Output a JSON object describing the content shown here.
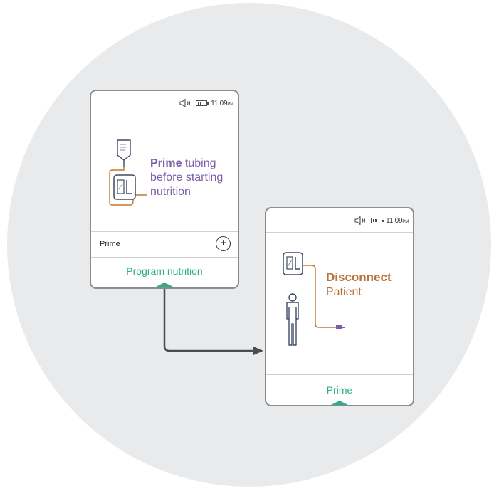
{
  "colors": {
    "accent": "#2fae85",
    "prime_purple": "#7b5ea7",
    "disconnect_orange": "#b9733a",
    "background_circle": "#e9eaeb",
    "device_border": "#8a8c8e",
    "connector": "#4a4c4e"
  },
  "screen_prime": {
    "status": {
      "time": "11:09",
      "ampm": "PM",
      "icons": [
        "speaker-icon",
        "battery-icon"
      ]
    },
    "message": {
      "bold": "Prime",
      "rest": " tubing before starting nutrition"
    },
    "illustration": [
      "iv-bag-icon",
      "pump-icon"
    ],
    "prime_row": {
      "label": "Prime",
      "action_icon": "plus-icon",
      "action_symbol": "+"
    },
    "footer": {
      "label": "Program nutrition"
    }
  },
  "screen_disconnect": {
    "status": {
      "time": "11:09",
      "ampm": "PM",
      "icons": [
        "speaker-icon",
        "battery-icon"
      ]
    },
    "message": {
      "bold": "Disconnect",
      "rest": "Patient"
    },
    "illustration": [
      "pump-icon",
      "person-icon",
      "connector-icon"
    ],
    "footer": {
      "label": "Prime"
    }
  },
  "flow": {
    "from": "screen_prime",
    "to": "screen_disconnect",
    "icon": "arrow-right-icon"
  }
}
